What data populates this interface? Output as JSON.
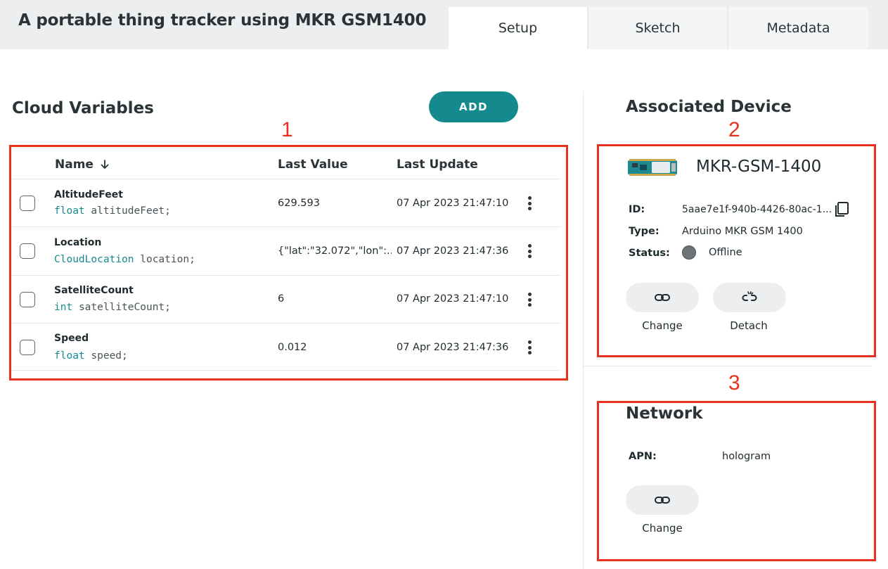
{
  "header": {
    "title": "A portable thing tracker using MKR GSM1400",
    "tabs": [
      {
        "label": "Setup",
        "active": true
      },
      {
        "label": "Sketch",
        "active": false
      },
      {
        "label": "Metadata",
        "active": false
      }
    ]
  },
  "cloud_variables": {
    "title": "Cloud Variables",
    "add_label": "ADD",
    "columns": {
      "name": "Name",
      "sort_icon": "arrow-down-icon",
      "last_value": "Last Value",
      "last_update": "Last Update"
    },
    "rows": [
      {
        "name": "AltitudeFeet",
        "type": "float",
        "decl": "altitudeFeet;",
        "last_value": "629.593",
        "last_update": "07 Apr 2023 21:47:10"
      },
      {
        "name": "Location",
        "type": "CloudLocation",
        "decl": "location;",
        "last_value": "{\"lat\":\"32.072\",\"lon\":...",
        "last_update": "07 Apr 2023 21:47:36"
      },
      {
        "name": "SatelliteCount",
        "type": "int",
        "decl": "satelliteCount;",
        "last_value": "6",
        "last_update": "07 Apr 2023 21:47:10"
      },
      {
        "name": "Speed",
        "type": "float",
        "decl": "speed;",
        "last_value": "0.012",
        "last_update": "07 Apr 2023 21:47:36"
      }
    ]
  },
  "associated_device": {
    "title": "Associated Device",
    "name": "MKR-GSM-1400",
    "id_label": "ID:",
    "id_value": "5aae7e1f-940b-4426-80ac-1...",
    "type_label": "Type:",
    "type_value": "Arduino MKR GSM 1400",
    "status_label": "Status:",
    "status_value": "Offline",
    "status_color": "#6d7478",
    "change_label": "Change",
    "detach_label": "Detach"
  },
  "network": {
    "title": "Network",
    "apn_label": "APN:",
    "apn_value": "hologram",
    "change_label": "Change"
  },
  "annotations": [
    "1",
    "2",
    "3"
  ],
  "colors": {
    "accent": "#148a8e",
    "annotation": "#e8321f"
  }
}
